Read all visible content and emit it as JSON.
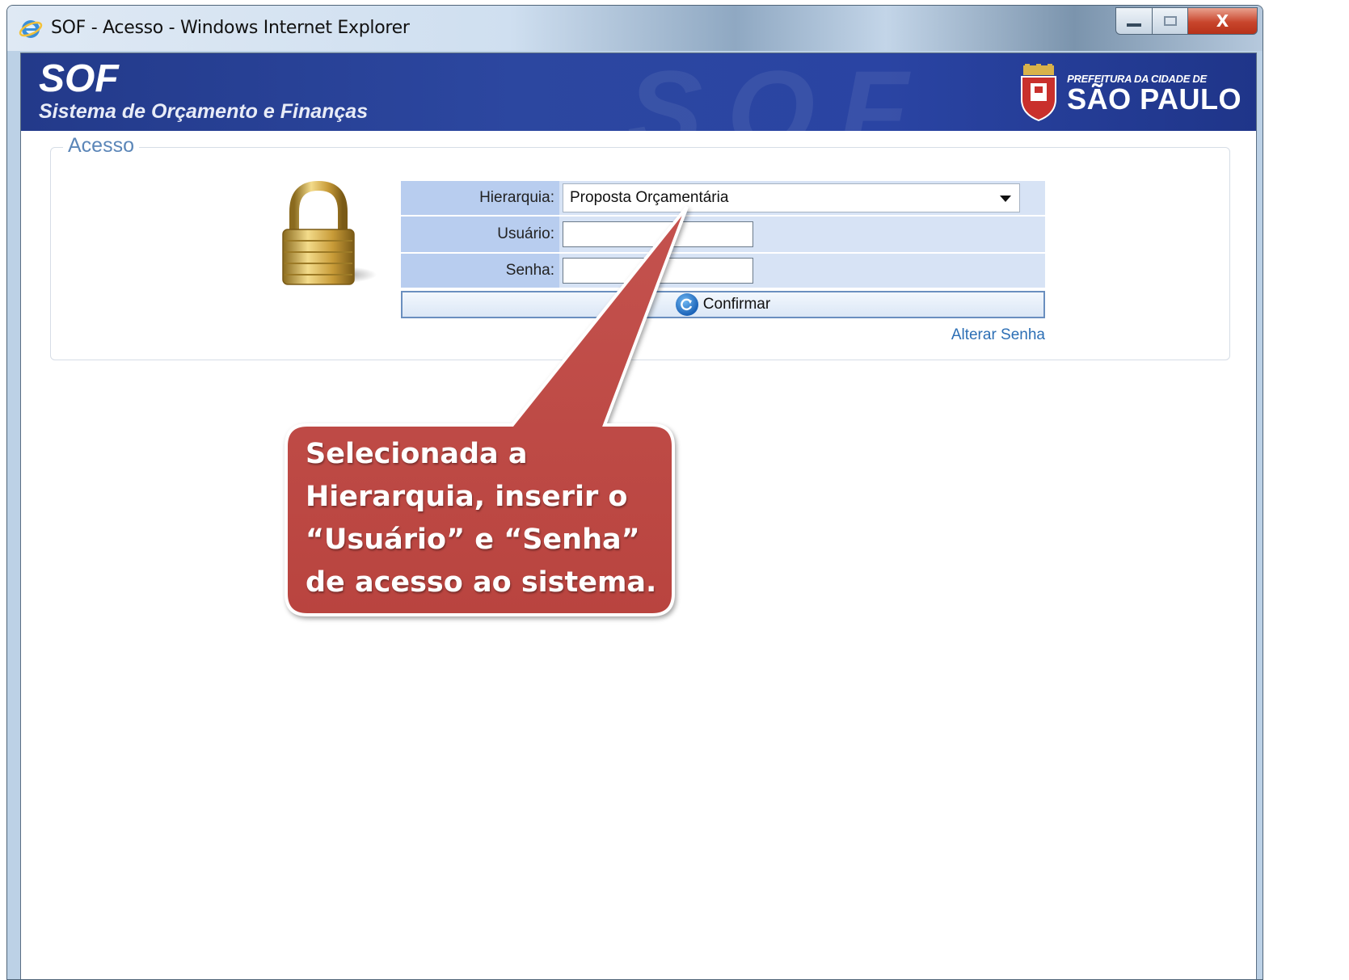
{
  "window": {
    "title": "SOF - Acesso - Windows Internet Explorer",
    "close_label": "X"
  },
  "header": {
    "app_short": "SOF",
    "app_full": "Sistema de Orçamento e Finanças",
    "watermark": "SOF",
    "logo_small": "PREFEITURA DA CIDADE DE",
    "logo_big": "SÃO PAULO"
  },
  "access": {
    "legend": "Acesso",
    "hierarquia_label": "Hierarquia:",
    "hierarquia_value": "Proposta Orçamentária",
    "usuario_label": "Usuário:",
    "usuario_value": "",
    "senha_label": "Senha:",
    "senha_value": "",
    "confirm_label": "Confirmar",
    "alterar_link": "Alterar Senha"
  },
  "callout": {
    "line1": "Selecionada a",
    "line2": "Hierarquia, inserir o",
    "line3": "“Usuário” e “Senha”",
    "line4": "de acesso ao sistema."
  },
  "colors": {
    "banner": "#2a44a3",
    "callout_fill": "#c0504d",
    "form_label_bg": "#b8cdef",
    "form_value_bg": "#d7e3f5",
    "link": "#2d6fb5"
  },
  "icons": [
    "ie-icon",
    "minimize-icon",
    "maximize-icon",
    "close-icon",
    "padlock-icon",
    "refresh-icon",
    "chevron-down-icon",
    "crest-icon"
  ]
}
